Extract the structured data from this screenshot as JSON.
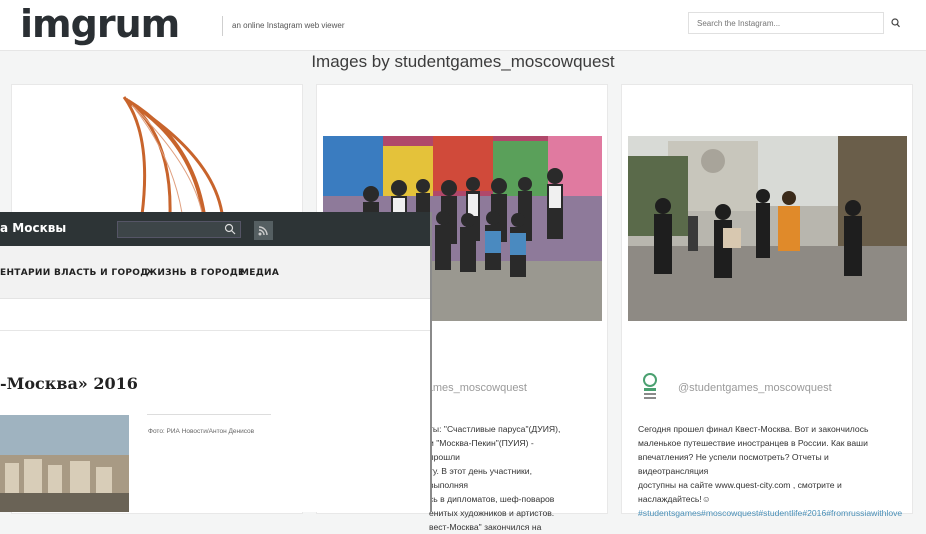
{
  "header": {
    "logo": "imgrum",
    "tagline": "an online Instagram web viewer",
    "search_placeholder": "Search the Instagram..."
  },
  "page_title": "Images by studentgames_moscowquest",
  "cards": [
    {
      "user": "",
      "caption": ""
    },
    {
      "user": "ames_moscowquest",
      "caption_lines": [
        "ты: \"Счастливые паруса\"(ДУИЯ),",
        "и \"Москва-Пекин\"(ПУИЯ) - прошли",
        "ту. В этот день участники, выполняя",
        "сь в дипломатов, шеф-поваров",
        "енитых художников и артистов.",
        "вест-Москва\" закончился на"
      ]
    },
    {
      "user": "@studentgames_moscowquest",
      "caption_lines": [
        "Сегодня прошел финал Квест-Москва. Вот и закончилось",
        "маленькое путешествие иностранцев в России. Как ваши",
        "впечатления? Не успели посмотреть? Отчеты и видеотрансляция",
        "доступны на сайте www.quest-city.com , смотрите и",
        "наслаждайтесь!☺"
      ],
      "tags": "#studentsgames#moscowquest#studentlife#2016#fromrussiawithlove"
    }
  ],
  "overlay": {
    "site_title": "а Москвы",
    "nav": [
      "ЕНТАРИИ",
      "ВЛАСТЬ И ГОРОД",
      "ЖИЗНЬ В ГОРОДЕ",
      "МЕДИА"
    ],
    "article_title": "-Москва» 2016",
    "photo_credit": "Фото: РИА Новости/Антон Денисов"
  },
  "colors": {
    "overlay_header": "#2d3436",
    "link": "#4a90b8"
  }
}
